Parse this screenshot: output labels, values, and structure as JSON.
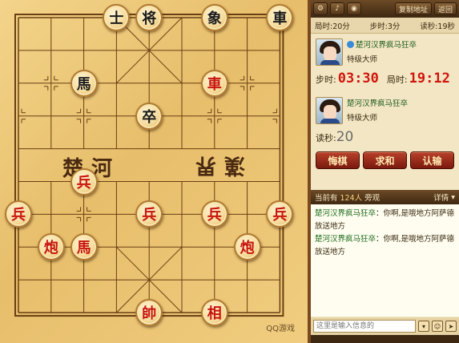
{
  "board": {
    "river_left": "楚河",
    "river_right": "漢界",
    "brand": "QQ游戏",
    "pieces": [
      {
        "char": "士",
        "side": "black",
        "col": 3,
        "row": 0
      },
      {
        "char": "将",
        "side": "black",
        "col": 4,
        "row": 0
      },
      {
        "char": "象",
        "side": "black",
        "col": 6,
        "row": 0
      },
      {
        "char": "車",
        "side": "black",
        "col": 8,
        "row": 0
      },
      {
        "char": "馬",
        "side": "black",
        "col": 2,
        "row": 2
      },
      {
        "char": "車",
        "side": "red",
        "col": 6,
        "row": 2
      },
      {
        "char": "卒",
        "side": "black",
        "col": 4,
        "row": 3
      },
      {
        "char": "兵",
        "side": "red",
        "col": 2,
        "row": 5
      },
      {
        "char": "兵",
        "side": "red",
        "col": 0,
        "row": 6
      },
      {
        "char": "兵",
        "side": "red",
        "col": 4,
        "row": 6
      },
      {
        "char": "兵",
        "side": "red",
        "col": 6,
        "row": 6
      },
      {
        "char": "兵",
        "side": "red",
        "col": 8,
        "row": 6
      },
      {
        "char": "炮",
        "side": "red",
        "col": 1,
        "row": 7
      },
      {
        "char": "馬",
        "side": "red",
        "col": 2,
        "row": 7
      },
      {
        "char": "炮",
        "side": "red",
        "col": 7,
        "row": 7
      },
      {
        "char": "帥",
        "side": "red",
        "col": 4,
        "row": 9
      },
      {
        "char": "相",
        "side": "red",
        "col": 6,
        "row": 9
      }
    ]
  },
  "panel": {
    "topbar": {
      "copy_address": "复制地址",
      "back": "返回"
    },
    "time_settings": {
      "game_time": "局时:20分",
      "step_time": "步时:3分",
      "read_seconds": "读秒:19秒"
    },
    "opponent": {
      "name": "楚河汉界疯马狂卒",
      "rank": "特级大师",
      "step_label": "步时:",
      "step_value": "03:30",
      "game_label": "局时:",
      "game_value": "19:12"
    },
    "self": {
      "name": "楚河汉界疯马狂卒",
      "rank": "特级大师",
      "read_label": "读秒:",
      "read_value": "20"
    },
    "actions": {
      "undo": "悔棋",
      "draw": "求和",
      "resign": "认输"
    },
    "spectators": {
      "prefix": "当前有",
      "count": "124人",
      "suffix": "旁观",
      "detail": "详情"
    },
    "chat": [
      {
        "name": "楚河汉界疯马狂卒",
        "text": "你啊,是哦地方阿萨德放送地方"
      },
      {
        "name": "楚河汉界疯马狂卒",
        "text": "你啊,是哦地方阿萨德放送地方"
      }
    ],
    "input": {
      "placeholder": "这里是输入信息的"
    }
  },
  "colors": {
    "red_piece": "#c8140c",
    "black_piece": "#1a1a1a",
    "timer_red": "#d0150c"
  }
}
